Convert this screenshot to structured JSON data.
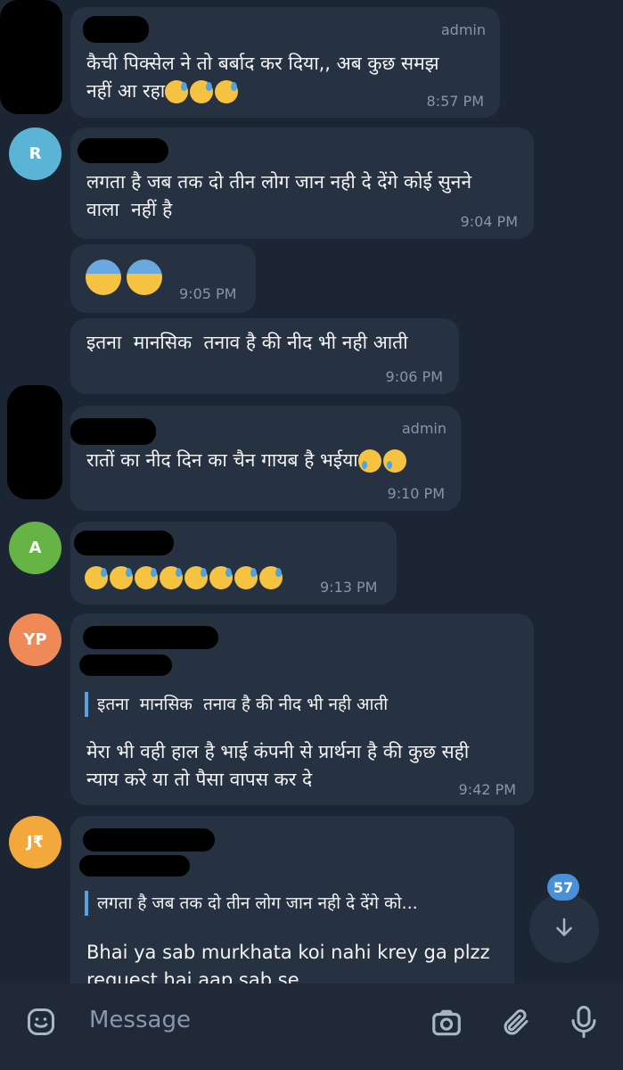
{
  "messages": [
    {
      "id": "m1",
      "role": "admin",
      "text": "कैची पिक्सेल ने तो बर्बाद कर दिया,, अब कुछ समझ\nनहीं आ रहा",
      "emoji": "sweat x3",
      "time": "8:57 PM"
    },
    {
      "id": "m2",
      "avatar": "R",
      "avatar_color": "#5bb3d6",
      "text": "लगता है जब तक दो तीन लोग जान नही दे देंगे कोई सुनने\nवाला  नहीं है",
      "time": "9:04 PM"
    },
    {
      "id": "m3",
      "emoji": "fear x2",
      "time": "9:05 PM"
    },
    {
      "id": "m4",
      "text": "इतना  मानसिक  तनाव है की नीद भी नही आती",
      "time": "9:06 PM"
    },
    {
      "id": "m5",
      "role": "admin",
      "text": "रातों का नीद दिन का चैन गायब है भईया",
      "emoji": "cry x2",
      "time": "9:10 PM"
    },
    {
      "id": "m6",
      "avatar": "A",
      "avatar_color": "#67b346",
      "emoji": "disappointed x8",
      "time": "9:13 PM"
    },
    {
      "id": "m7",
      "avatar": "YP",
      "avatar_color": "#ef8957",
      "quote": "इतना  मानसिक  तनाव है की नीद भी नही आती",
      "text": "मेरा भी वही हाल है भाई कंपनी से प्रार्थना है की कुछ सही\nन्याय करे या तो पैसा वापस कर दे",
      "time": "9:42 PM"
    },
    {
      "id": "m8",
      "avatar": "J₹",
      "avatar_color": "#f2a83b",
      "quote": "लगता है जब तक दो तीन लोग जान नही दे देंगे को...",
      "text": "Bhai ya sab murkhata koi nahi krey ga plzz\nrequest hai aap sab se"
    }
  ],
  "unread_count": "57",
  "input": {
    "placeholder": "Message"
  },
  "icons": {
    "emoji": "emoji-sticker-icon",
    "camera": "camera-icon",
    "attach": "paperclip-icon",
    "mic": "microphone-icon",
    "scroll": "arrow-down-icon"
  },
  "colors": {
    "background": "#1c2533",
    "bubble": "#263241",
    "accent": "#4a90d9",
    "quote_bar": "#5ea1de"
  }
}
